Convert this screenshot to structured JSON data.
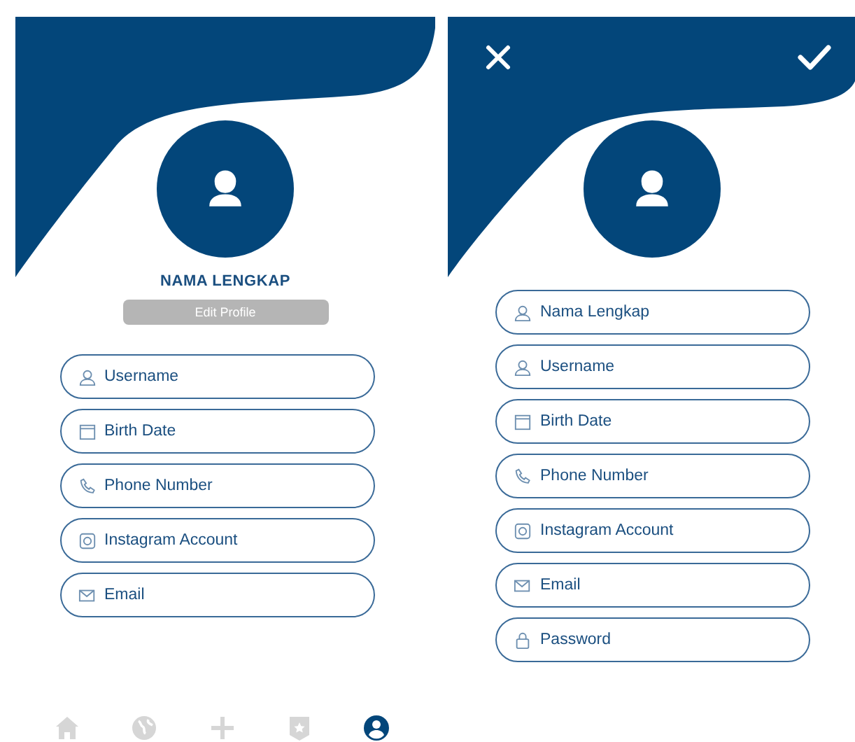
{
  "profile_screen": {
    "name": "NAMA LENGKAP",
    "edit_button": "Edit Profile",
    "fields": [
      {
        "kind": "user",
        "label": "Username"
      },
      {
        "kind": "calendar",
        "label": "Birth Date"
      },
      {
        "kind": "phone",
        "label": "Phone Number"
      },
      {
        "kind": "instagram",
        "label": "Instagram Account"
      },
      {
        "kind": "mail",
        "label": "Email"
      }
    ],
    "nav": [
      {
        "kind": "home",
        "selected": false
      },
      {
        "kind": "globe",
        "selected": false
      },
      {
        "kind": "plus",
        "selected": false
      },
      {
        "kind": "badge",
        "selected": false
      },
      {
        "kind": "account",
        "selected": true
      }
    ]
  },
  "edit_screen": {
    "fields": [
      {
        "kind": "user",
        "placeholder": "Nama Lengkap"
      },
      {
        "kind": "user",
        "placeholder": "Username"
      },
      {
        "kind": "calendar",
        "placeholder": "Birth Date"
      },
      {
        "kind": "phone",
        "placeholder": "Phone Number"
      },
      {
        "kind": "instagram",
        "placeholder": "Instagram Account"
      },
      {
        "kind": "mail",
        "placeholder": "Email"
      },
      {
        "kind": "lock",
        "placeholder": "Password"
      }
    ]
  }
}
